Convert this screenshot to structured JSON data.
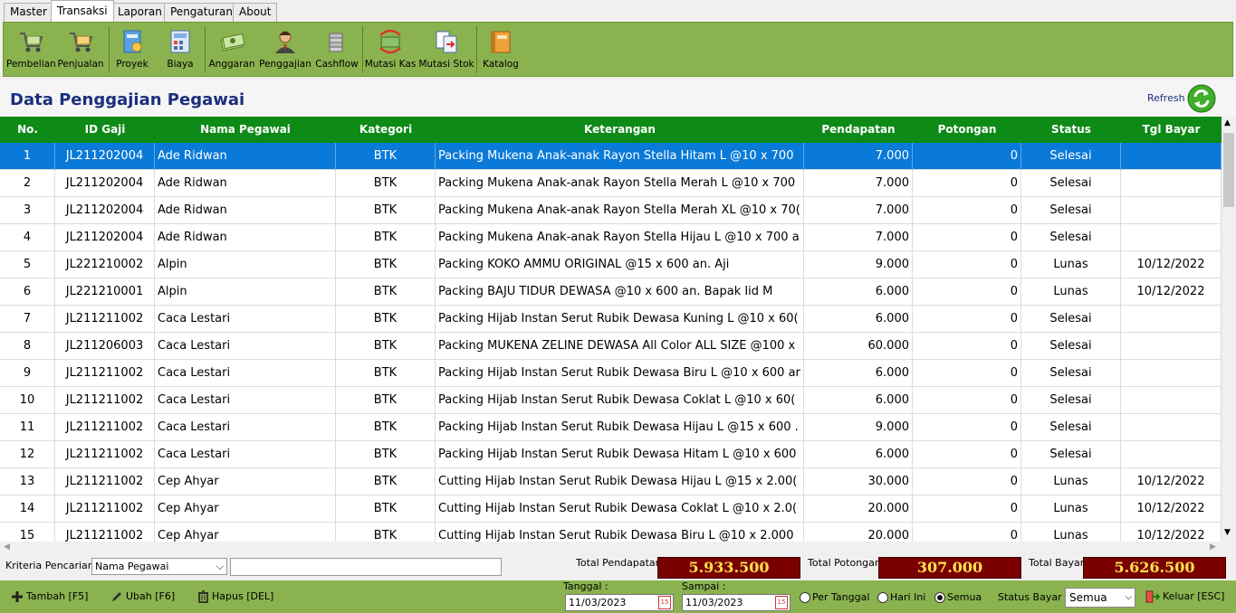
{
  "menu": [
    "Master",
    "Transaksi",
    "Laporan",
    "Pengaturan",
    "About"
  ],
  "toolbar": [
    {
      "label": "Pembelian",
      "icon": "cart-icon"
    },
    {
      "label": "Penjualan",
      "icon": "cart-icon"
    },
    {
      "label": "Proyek",
      "icon": "project-icon"
    },
    {
      "label": "Biaya",
      "icon": "calculator-icon"
    },
    {
      "label": "Anggaran",
      "icon": "money-icon"
    },
    {
      "label": "Penggajian",
      "icon": "user-icon"
    },
    {
      "label": "Cashflow",
      "icon": "coins-icon"
    },
    {
      "label": "Mutasi Kas",
      "icon": "cash-transfer-icon"
    },
    {
      "label": "Mutasi Stok",
      "icon": "stock-transfer-icon"
    },
    {
      "label": "Katalog",
      "icon": "catalog-icon"
    }
  ],
  "page": {
    "title": "Data Penggajian Pegawai",
    "refresh": "Refresh"
  },
  "columns": [
    "No.",
    "ID Gaji",
    "Nama Pegawai",
    "Kategori",
    "Keterangan",
    "Pendapatan",
    "Potongan",
    "Status",
    "Tgl Bayar"
  ],
  "rows": [
    [
      "1",
      "JL211202004",
      "Ade Ridwan",
      "BTK",
      "Packing Mukena Anak-anak Rayon Stella Hitam L @10 x 700",
      "7.000",
      "0",
      "Selesai",
      ""
    ],
    [
      "2",
      "JL211202004",
      "Ade Ridwan",
      "BTK",
      "Packing Mukena Anak-anak Rayon Stella Merah L @10 x 700",
      "7.000",
      "0",
      "Selesai",
      ""
    ],
    [
      "3",
      "JL211202004",
      "Ade Ridwan",
      "BTK",
      "Packing Mukena Anak-anak Rayon Stella Merah XL @10 x 70(",
      "7.000",
      "0",
      "Selesai",
      ""
    ],
    [
      "4",
      "JL211202004",
      "Ade Ridwan",
      "BTK",
      "Packing Mukena Anak-anak Rayon Stella Hijau L @10 x 700 a",
      "7.000",
      "0",
      "Selesai",
      ""
    ],
    [
      "5",
      "JL221210002",
      "Alpin",
      "BTK",
      "Packing KOKO AMMU ORIGINAL   @15 x 600 an. Aji",
      "9.000",
      "0",
      "Lunas",
      "10/12/2022"
    ],
    [
      "6",
      "JL221210001",
      "Alpin",
      "BTK",
      "Packing BAJU TIDUR DEWASA   @10 x 600 an. Bapak Iid M",
      "6.000",
      "0",
      "Lunas",
      "10/12/2022"
    ],
    [
      "7",
      "JL211211002",
      "Caca Lestari",
      "BTK",
      "Packing Hijab Instan Serut Rubik Dewasa Kuning L @10 x 60(",
      "6.000",
      "0",
      "Selesai",
      ""
    ],
    [
      "8",
      "JL211206003",
      "Caca Lestari",
      "BTK",
      "Packing MUKENA ZELINE DEWASA  All Color ALL SIZE @100 x",
      "60.000",
      "0",
      "Selesai",
      ""
    ],
    [
      "9",
      "JL211211002",
      "Caca Lestari",
      "BTK",
      "Packing Hijab Instan Serut Rubik Dewasa Biru L @10 x 600 ar",
      "6.000",
      "0",
      "Selesai",
      ""
    ],
    [
      "10",
      "JL211211002",
      "Caca Lestari",
      "BTK",
      "Packing Hijab Instan Serut Rubik Dewasa Coklat L @10 x 60(",
      "6.000",
      "0",
      "Selesai",
      ""
    ],
    [
      "11",
      "JL211211002",
      "Caca Lestari",
      "BTK",
      "Packing Hijab Instan Serut Rubik Dewasa Hijau L @15 x 600 .",
      "9.000",
      "0",
      "Selesai",
      ""
    ],
    [
      "12",
      "JL211211002",
      "Caca Lestari",
      "BTK",
      "Packing Hijab Instan Serut Rubik Dewasa Hitam L @10 x 600",
      "6.000",
      "0",
      "Selesai",
      ""
    ],
    [
      "13",
      "JL211211002",
      "Cep Ahyar",
      "BTK",
      "Cutting Hijab Instan Serut Rubik Dewasa Hijau L @15 x 2.00(",
      "30.000",
      "0",
      "Lunas",
      "10/12/2022"
    ],
    [
      "14",
      "JL211211002",
      "Cep Ahyar",
      "BTK",
      "Cutting Hijab Instan Serut Rubik Dewasa Coklat L @10 x 2.0(",
      "20.000",
      "0",
      "Lunas",
      "10/12/2022"
    ],
    [
      "15",
      "JL211211002",
      "Cep Ahyar",
      "BTK",
      "Cutting Hijab Instan Serut Rubik Dewasa Biru L @10 x 2.000",
      "20.000",
      "0",
      "Lunas",
      "10/12/2022"
    ]
  ],
  "search": {
    "label": "Kriteria Pencarian :",
    "criteria": "Nama Pegawai",
    "value": ""
  },
  "totals": {
    "pendapatan_label": "Total Pendapatan",
    "pendapatan": "5.933.500",
    "potongan_label": "Total Potongan",
    "potongan": "307.000",
    "bayar_label": "Total Bayar",
    "bayar": "5.626.500"
  },
  "actions": {
    "add": "Tambah [F5]",
    "edit": "Ubah [F6]",
    "delete": "Hapus [DEL]",
    "exit": "Keluar [ESC]"
  },
  "filter": {
    "tanggal_label": "Tanggal :",
    "tanggal": "11/03/2023",
    "sampai_label": "Sampai :",
    "sampai": "11/03/2023",
    "cal_glyph": "15",
    "radio": [
      "Per Tanggal",
      "Hari Ini",
      "Semua"
    ],
    "selected_radio": 2,
    "status_label": "Status Bayar :",
    "status": "Semua"
  },
  "colors": {
    "header": "#0e8a17",
    "toolbar": "#8ab34f",
    "selected": "#0a7ad8",
    "total_box": "#7a0000",
    "total_text": "#ffe24a"
  }
}
